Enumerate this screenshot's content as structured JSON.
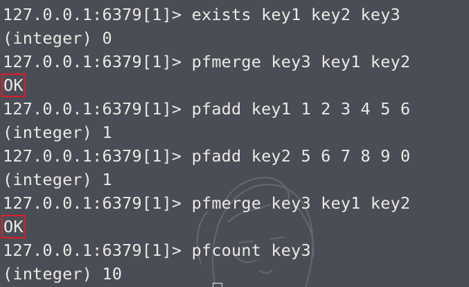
{
  "colors": {
    "background": "#4a4d55",
    "text": "#eceae6",
    "highlight_box": "#e01b24"
  },
  "lines": [
    {
      "type": "command",
      "prompt": "127.0.0.1:6379[1]>",
      "command": "exists key1 key2 key3"
    },
    {
      "type": "output",
      "text": "(integer) 0"
    },
    {
      "type": "command",
      "prompt": "127.0.0.1:6379[1]>",
      "command": "pfmerge key3 key1 key2"
    },
    {
      "type": "output-highlight",
      "text": "OK"
    },
    {
      "type": "command",
      "prompt": "127.0.0.1:6379[1]>",
      "command": "pfadd key1 1 2 3 4 5 6"
    },
    {
      "type": "output",
      "text": "(integer) 1"
    },
    {
      "type": "command",
      "prompt": "127.0.0.1:6379[1]>",
      "command": "pfadd key2 5 6 7 8 9 0"
    },
    {
      "type": "output",
      "text": "(integer) 1"
    },
    {
      "type": "command",
      "prompt": "127.0.0.1:6379[1]>",
      "command": "pfmerge key3 key1 key2"
    },
    {
      "type": "output-highlight",
      "text": "OK"
    },
    {
      "type": "command",
      "prompt": "127.0.0.1:6379[1]>",
      "command": "pfcount key3"
    },
    {
      "type": "output",
      "text": "(integer) 10"
    }
  ]
}
